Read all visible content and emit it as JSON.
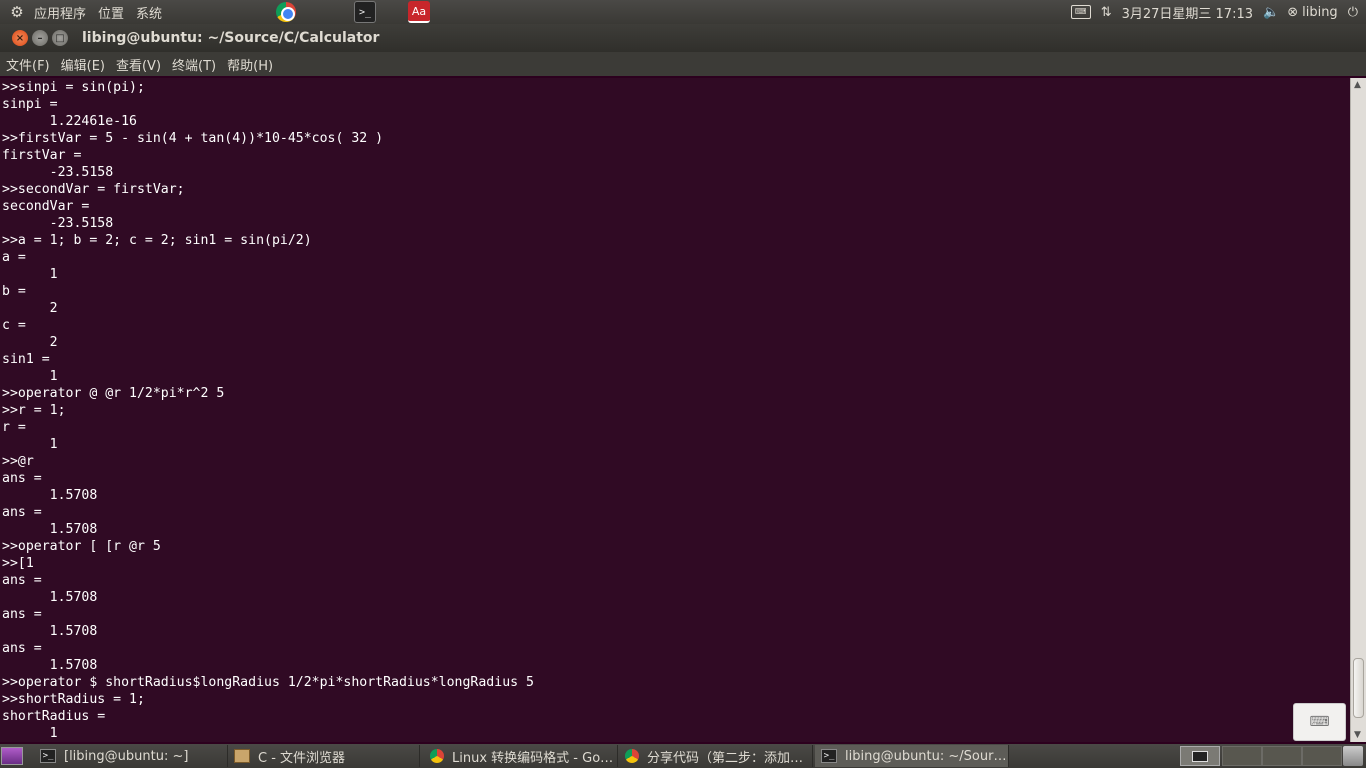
{
  "top_panel": {
    "menus": [
      "应用程序",
      "位置",
      "系统"
    ],
    "datetime": "3月27日星期三 17:13",
    "user": "libing",
    "dict_label": "Aa"
  },
  "window": {
    "title": "libing@ubuntu: ~/Source/C/Calculator",
    "menus": [
      "文件(F)",
      "编辑(E)",
      "查看(V)",
      "终端(T)",
      "帮助(H)"
    ]
  },
  "terminal": {
    "lines": [
      ">>sinpi = sin(pi);",
      "sinpi =",
      "      1.22461e-16",
      ">>firstVar = 5 - sin(4 + tan(4))*10-45*cos( 32 )",
      "firstVar =",
      "      -23.5158",
      ">>secondVar = firstVar;",
      "secondVar =",
      "      -23.5158",
      ">>a = 1; b = 2; c = 2; sin1 = sin(pi/2)",
      "a =",
      "      1",
      "b =",
      "      2",
      "c =",
      "      2",
      "sin1 =",
      "      1",
      ">>operator @ @r 1/2*pi*r^2 5",
      ">>r = 1;",
      "r =",
      "      1",
      ">>@r",
      "ans =",
      "      1.5708",
      "ans =",
      "      1.5708",
      ">>operator [ [r @r 5",
      ">>[1",
      "ans =",
      "      1.5708",
      "ans =",
      "      1.5708",
      "ans =",
      "      1.5708",
      ">>operator $ shortRadius$longRadius 1/2*pi*shortRadius*longRadius 5",
      ">>shortRadius = 1;",
      "shortRadius =",
      "      1"
    ]
  },
  "taskbar": {
    "tasks": [
      {
        "label": "[libing@ubuntu: ~]",
        "icon": "terminal-icon"
      },
      {
        "label": "C - 文件浏览器",
        "icon": "file-manager-icon"
      },
      {
        "label": "Linux 转换编码格式 - Go…",
        "icon": "chrome-icon"
      },
      {
        "label": "分享代码（第二步：添加…",
        "icon": "chrome-icon"
      },
      {
        "label": "libing@ubuntu: ~/Sour…",
        "icon": "terminal-icon"
      }
    ]
  },
  "colors": {
    "terminal_bg": "#300a24",
    "terminal_fg": "#ffffff",
    "panel_bg": "#3c3b37",
    "accent": "#dd4814"
  }
}
